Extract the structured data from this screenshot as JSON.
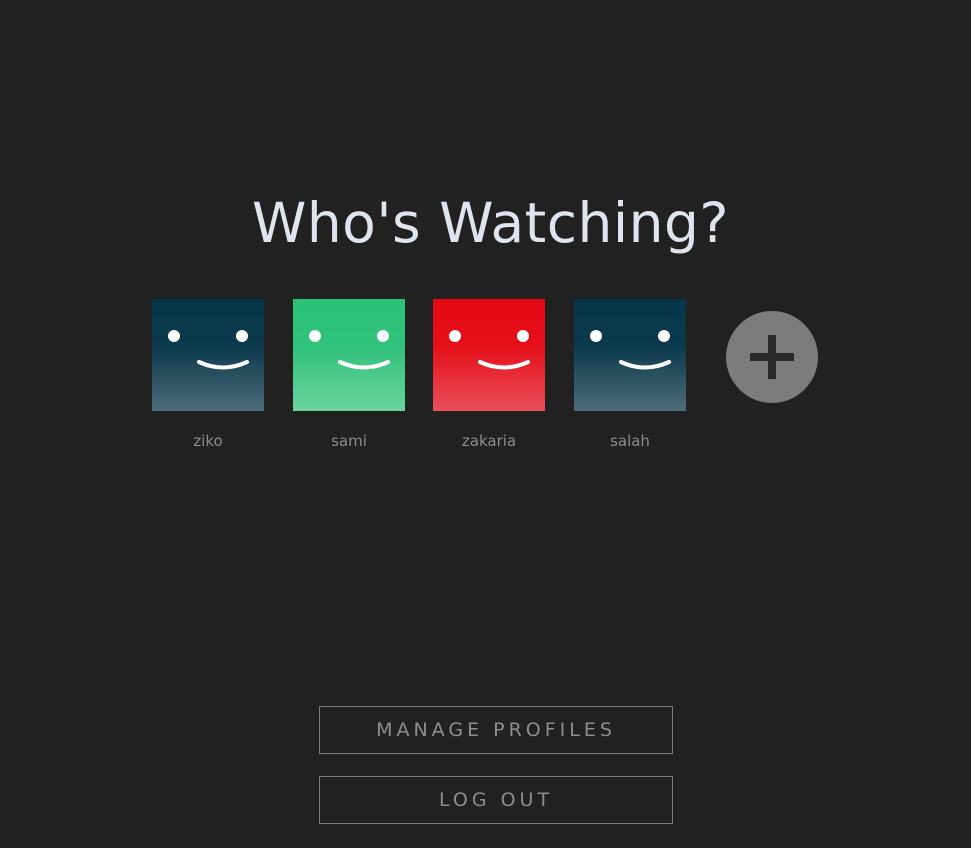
{
  "heading": "Who's Watching?",
  "profiles": [
    {
      "name": "ziko",
      "color_top": "#053547",
      "color_bottom": "#4f6c7c"
    },
    {
      "name": "sami",
      "color_top": "#2bc177",
      "color_bottom": "#6bd49c"
    },
    {
      "name": "zakaria",
      "color_top": "#e50914",
      "color_bottom": "#e9505a"
    },
    {
      "name": "salah",
      "color_top": "#053547",
      "color_bottom": "#4f6c7c"
    }
  ],
  "add_profile": {
    "icon": "plus-icon",
    "color": "#7c7c7c"
  },
  "buttons": {
    "manage": "MANAGE PROFILES",
    "logout": "LOG OUT"
  },
  "colors": {
    "background": "#212121",
    "heading": "#dfe5ee",
    "muted_text": "#8c8c8c"
  }
}
